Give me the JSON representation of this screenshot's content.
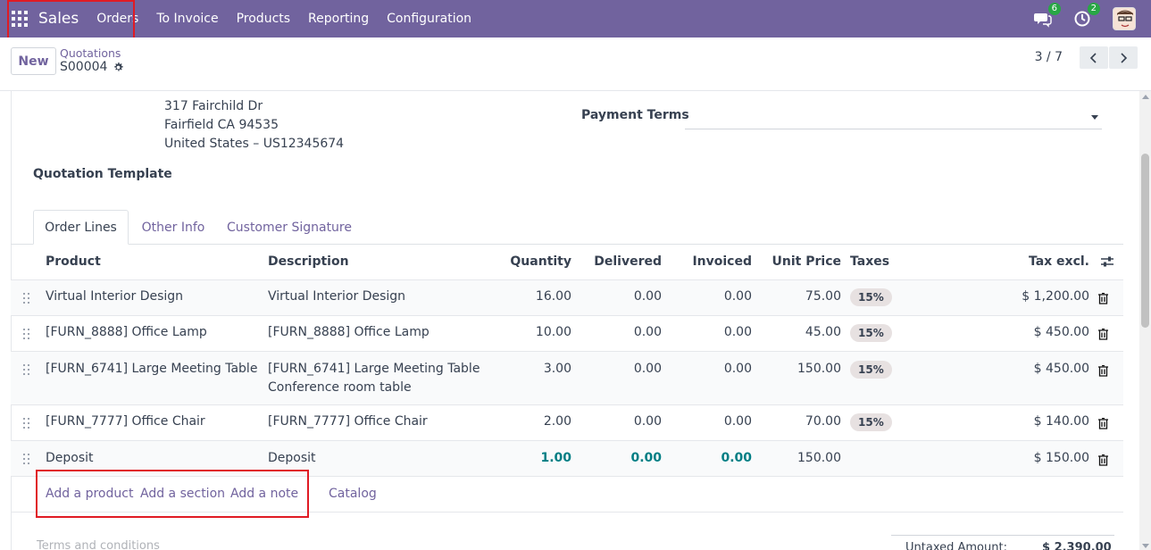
{
  "nav": {
    "app_name": "Sales",
    "items": [
      "Orders",
      "To Invoice",
      "Products",
      "Reporting",
      "Configuration"
    ],
    "messages_count": "6",
    "activities_count": "2"
  },
  "control": {
    "new_label": "New",
    "breadcrumb": "Quotations",
    "record_name": "S00004",
    "pager": "3 / 7"
  },
  "customer_address": [
    "317 Fairchild Dr",
    "Fairfield CA 94535",
    "United States – US12345674"
  ],
  "payment_terms_label": "Payment Terms",
  "quotation_template_label": "Quotation Template",
  "tabs": [
    "Order Lines",
    "Other Info",
    "Customer Signature"
  ],
  "table": {
    "headers": {
      "product": "Product",
      "description": "Description",
      "quantity": "Quantity",
      "delivered": "Delivered",
      "invoiced": "Invoiced",
      "unit_price": "Unit Price",
      "taxes": "Taxes",
      "tax_excl": "Tax excl."
    },
    "rows": [
      {
        "product": "Virtual Interior Design",
        "description": "Virtual Interior Design",
        "description2": "",
        "quantity": "16.00",
        "delivered": "0.00",
        "invoiced": "0.00",
        "unit_price": "75.00",
        "tax": "15%",
        "subtotal": "$ 1,200.00"
      },
      {
        "product": "[FURN_8888] Office Lamp",
        "description": "[FURN_8888] Office Lamp",
        "description2": "",
        "quantity": "10.00",
        "delivered": "0.00",
        "invoiced": "0.00",
        "unit_price": "45.00",
        "tax": "15%",
        "subtotal": "$ 450.00"
      },
      {
        "product": "[FURN_6741] Large Meeting Table",
        "description": "[FURN_6741] Large Meeting Table",
        "description2": "Conference room table",
        "quantity": "3.00",
        "delivered": "0.00",
        "invoiced": "0.00",
        "unit_price": "150.00",
        "tax": "15%",
        "subtotal": "$ 450.00"
      },
      {
        "product": "[FURN_7777] Office Chair",
        "description": "[FURN_7777] Office Chair",
        "description2": "",
        "quantity": "2.00",
        "delivered": "0.00",
        "invoiced": "0.00",
        "unit_price": "70.00",
        "tax": "15%",
        "subtotal": "$ 140.00"
      },
      {
        "product": "Deposit",
        "description": "Deposit",
        "description2": "",
        "quantity": "1.00",
        "delivered": "0.00",
        "invoiced": "0.00",
        "unit_price": "150.00",
        "tax": "",
        "subtotal": "$ 150.00"
      }
    ],
    "add_links": {
      "add_product": "Add a product",
      "add_section": "Add a section",
      "add_note": "Add a note",
      "catalog": "Catalog"
    }
  },
  "terms_placeholder": "Terms and conditions",
  "totals": {
    "untaxed_label": "Untaxed Amount:",
    "untaxed_value": "$ 2,390.00"
  },
  "colors": {
    "brand": "#71639e",
    "highlight": "#e01b24",
    "deposit_values": "#017e84"
  }
}
